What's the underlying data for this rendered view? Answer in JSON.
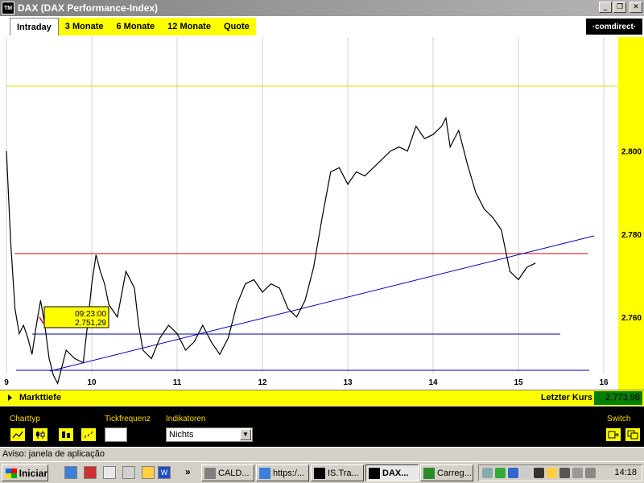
{
  "window": {
    "app_icon": "TM",
    "title": "DAX (DAX Performance-Index)",
    "buttons": [
      "_",
      "❐",
      "✕"
    ]
  },
  "tabs": [
    {
      "label": "Intraday",
      "active": true
    },
    {
      "label": "3 Monate",
      "active": false
    },
    {
      "label": "6 Monate",
      "active": false
    },
    {
      "label": "12 Monate",
      "active": false
    },
    {
      "label": "Quote",
      "active": false
    }
  ],
  "brand": "·comdirect·",
  "chart_data": {
    "type": "line",
    "x_ticks": [
      "9",
      "10",
      "11",
      "12",
      "13",
      "14",
      "15",
      "16"
    ],
    "y_ticks": [
      "2.760",
      "2.780",
      "2.800"
    ],
    "xlim": [
      9,
      16
    ],
    "ylim": [
      2.7425,
      2.8275
    ],
    "series": [
      {
        "x": [
          9.0,
          9.05,
          9.1,
          9.15,
          9.2,
          9.25,
          9.3,
          9.35,
          9.4,
          9.45,
          9.5,
          9.55,
          9.6,
          9.65,
          9.7,
          9.8,
          9.9,
          9.95,
          10.0,
          10.05,
          10.1,
          10.15,
          10.2,
          10.3,
          10.4,
          10.5,
          10.55,
          10.6,
          10.7,
          10.8,
          10.9,
          11.0,
          11.1,
          11.2,
          11.3,
          11.4,
          11.5,
          11.6,
          11.7,
          11.8,
          11.9,
          12.0,
          12.1,
          12.2,
          12.3,
          12.4,
          12.5,
          12.6,
          12.7,
          12.8,
          12.9,
          13.0,
          13.1,
          13.2,
          13.3,
          13.4,
          13.5,
          13.6,
          13.7,
          13.8,
          13.9,
          14.0,
          14.1,
          14.15,
          14.2,
          14.3,
          14.4,
          14.5,
          14.6,
          14.7,
          14.8,
          14.9,
          15.0,
          15.1,
          15.2
        ],
        "values": [
          2.8,
          2.778,
          2.762,
          2.756,
          2.758,
          2.755,
          2.751,
          2.758,
          2.764,
          2.758,
          2.75,
          2.746,
          2.744,
          2.748,
          2.752,
          2.75,
          2.749,
          2.758,
          2.768,
          2.775,
          2.771,
          2.768,
          2.763,
          2.76,
          2.771,
          2.767,
          2.758,
          2.752,
          2.75,
          2.755,
          2.758,
          2.756,
          2.752,
          2.754,
          2.758,
          2.754,
          2.751,
          2.755,
          2.763,
          2.768,
          2.769,
          2.766,
          2.768,
          2.767,
          2.762,
          2.76,
          2.764,
          2.772,
          2.784,
          2.795,
          2.796,
          2.792,
          2.795,
          2.794,
          2.796,
          2.798,
          2.8,
          2.801,
          2.8,
          2.806,
          2.803,
          2.804,
          2.806,
          2.808,
          2.801,
          2.805,
          2.797,
          2.79,
          2.786,
          2.784,
          2.781,
          2.771,
          2.769,
          2.772,
          2.773
        ]
      }
    ],
    "grid": true
  },
  "tooltip": {
    "time": "09:23:00",
    "price": "2.751,29"
  },
  "market": {
    "depth_label": "Markttiefe",
    "last_label": "Letzter Kurs",
    "last_value": "2.773,98"
  },
  "controls": {
    "charttyp_label": "Charttyp",
    "tick_label": "Tickfrequenz",
    "ind_label": "Indikatoren",
    "ind_value": "Nichts",
    "switch_label": "Switch"
  },
  "status": "Aviso: janela de aplicação",
  "taskbar": {
    "start": "Iniciar",
    "quicklaunch_more": "»",
    "tasks": [
      {
        "label": "CALD...",
        "active": false
      },
      {
        "label": "https:/...",
        "active": false
      },
      {
        "label": "IS.Tra...",
        "active": false
      },
      {
        "label": "DAX...",
        "active": true
      },
      {
        "label": "Carreg...",
        "active": false
      }
    ],
    "clock": "14:18"
  },
  "colors": {
    "accent_yellow": "#ffff00",
    "price_line": "#000000",
    "trend_line": "#0000cc",
    "support_line": "#cc0000",
    "hi_line": "#dddd00",
    "last_value_bg": "#008000"
  }
}
